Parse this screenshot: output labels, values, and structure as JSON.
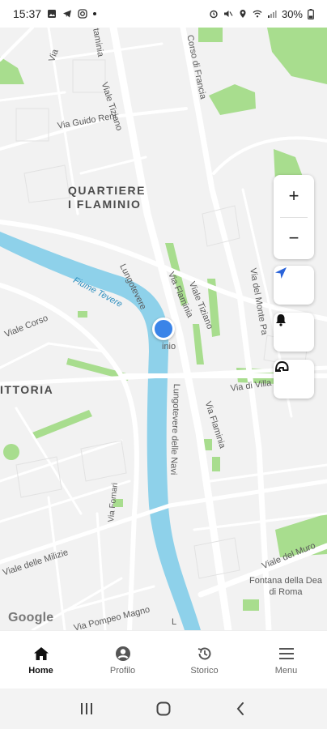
{
  "status_bar": {
    "time": "15:37",
    "battery": "30%",
    "icons_left": [
      "gallery-icon",
      "telegram-icon",
      "instagram-icon",
      "dot-icon"
    ],
    "icons_right": [
      "alarm-icon",
      "mute-icon",
      "location-icon",
      "wifi-icon",
      "signal-icon",
      "battery-icon"
    ]
  },
  "map": {
    "labels": {
      "district_1": "QUARTIERE",
      "district_2": "I FLAMINIO",
      "district_3": "ITTORIA",
      "viale_tiziano_1": "Viale Tiziano",
      "viale_tiziano_2": "Viale Tiziano",
      "corso_francia": "Corso di Francia",
      "via_guido_reni": "Via Guido Reni",
      "via_flaminia_top": "taminia",
      "via_flaminia": "Via Flaminia",
      "lungotevere": "Lungotevere",
      "lungotevere_end": "inio",
      "fiume_tevere": "Fiume Tevere",
      "lungotevere_navi": "Lungotevere delle Navi",
      "via_di_villa_giulia": "Via di Villa Giuli",
      "via_flaminia_2": "Via Flaminia",
      "viale_corso": "Viale Corso",
      "via_del_monte": "Via del Monte Pa",
      "via_pompeo_magno": "Via Pompeo Magno",
      "via_fornari": "Via Fornari",
      "viale_milizie": "Viale delle Milizie",
      "viale_del_muro": "Viale del Muro",
      "fontana": "Fontana della Dea di Roma",
      "via_top_left": "Via",
      "lungotevere_bottom": "L"
    },
    "google_logo": "Google",
    "colors": {
      "background": "#f2f2f2",
      "road": "#ffffff",
      "park": "#a8dd8e",
      "river": "#8ed1ea",
      "user_dot": "#3a84e8",
      "accent": "#2a63d9"
    }
  },
  "controls": {
    "zoom_in": "+",
    "zoom_out": "−",
    "locate_icon": "navigation-arrow-icon",
    "notify_icon": "bell-icon",
    "helmet_icon": "helmet-icon"
  },
  "bottom_nav": {
    "items": [
      {
        "label": "Home",
        "icon": "home-icon",
        "active": true
      },
      {
        "label": "Profilo",
        "icon": "profile-icon",
        "active": false
      },
      {
        "label": "Storico",
        "icon": "history-icon",
        "active": false
      },
      {
        "label": "Menu",
        "icon": "menu-icon",
        "active": false
      }
    ]
  },
  "system_nav": [
    "recents-icon",
    "home-circle-icon",
    "back-icon"
  ]
}
